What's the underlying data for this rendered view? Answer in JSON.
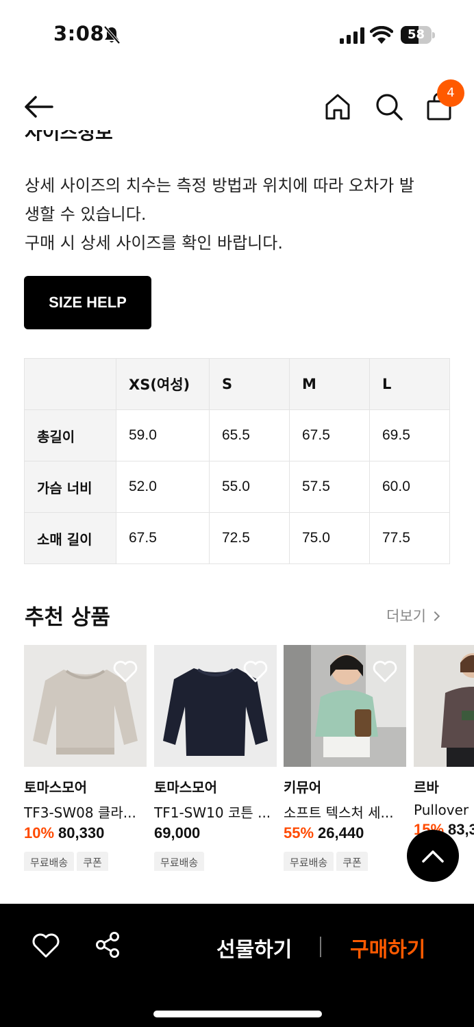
{
  "status_bar": {
    "time": "3:08",
    "battery": "58",
    "battery_level": 0.58
  },
  "header": {
    "cart_count": "4"
  },
  "section_heading": "사이즈정보",
  "notice": {
    "line1": "상세 사이즈의 치수는 측정 방법과 위치에 따라 오차가 발",
    "line2": "생할 수 있습니다.",
    "line3": "구매 시 상세 사이즈를 확인 바랍니다."
  },
  "size_help_label": "SIZE HELP",
  "size_table": {
    "headers": [
      "",
      "XS(여성)",
      "S",
      "M",
      "L"
    ],
    "rows": [
      {
        "label": "총길이",
        "values": [
          "59.0",
          "65.5",
          "67.5",
          "69.5"
        ]
      },
      {
        "label": "가슴 너비",
        "values": [
          "52.0",
          "55.0",
          "57.5",
          "60.0"
        ]
      },
      {
        "label": "소매 길이",
        "values": [
          "67.5",
          "72.5",
          "75.0",
          "77.5"
        ]
      }
    ]
  },
  "recommend": {
    "title": "추천 상품",
    "more_label": "더보기",
    "products": [
      {
        "brand": "토마스모어",
        "name": "TF3-SW08 클라...",
        "discount": "10%",
        "price": "80,330",
        "tags": [
          "무료배송",
          "쿠폰"
        ]
      },
      {
        "brand": "토마스모어",
        "name": "TF1-SW10 코튼 ...",
        "discount": "",
        "price": "69,000",
        "tags": [
          "무료배송"
        ]
      },
      {
        "brand": "키뮤어",
        "name": "소프트 텍스처 세...",
        "discount": "55%",
        "price": "26,440",
        "tags": [
          "무료배송",
          "쿠폰"
        ]
      },
      {
        "brand": "르바",
        "name": "Pullover P",
        "discount": "15%",
        "price": "83,3",
        "tags": []
      }
    ]
  },
  "bottom_bar": {
    "gift_label": "선물하기",
    "buy_label": "구매하기"
  },
  "colors": {
    "accent": "#ff5a00",
    "black": "#000000",
    "table_header": "#f4f4f4"
  }
}
